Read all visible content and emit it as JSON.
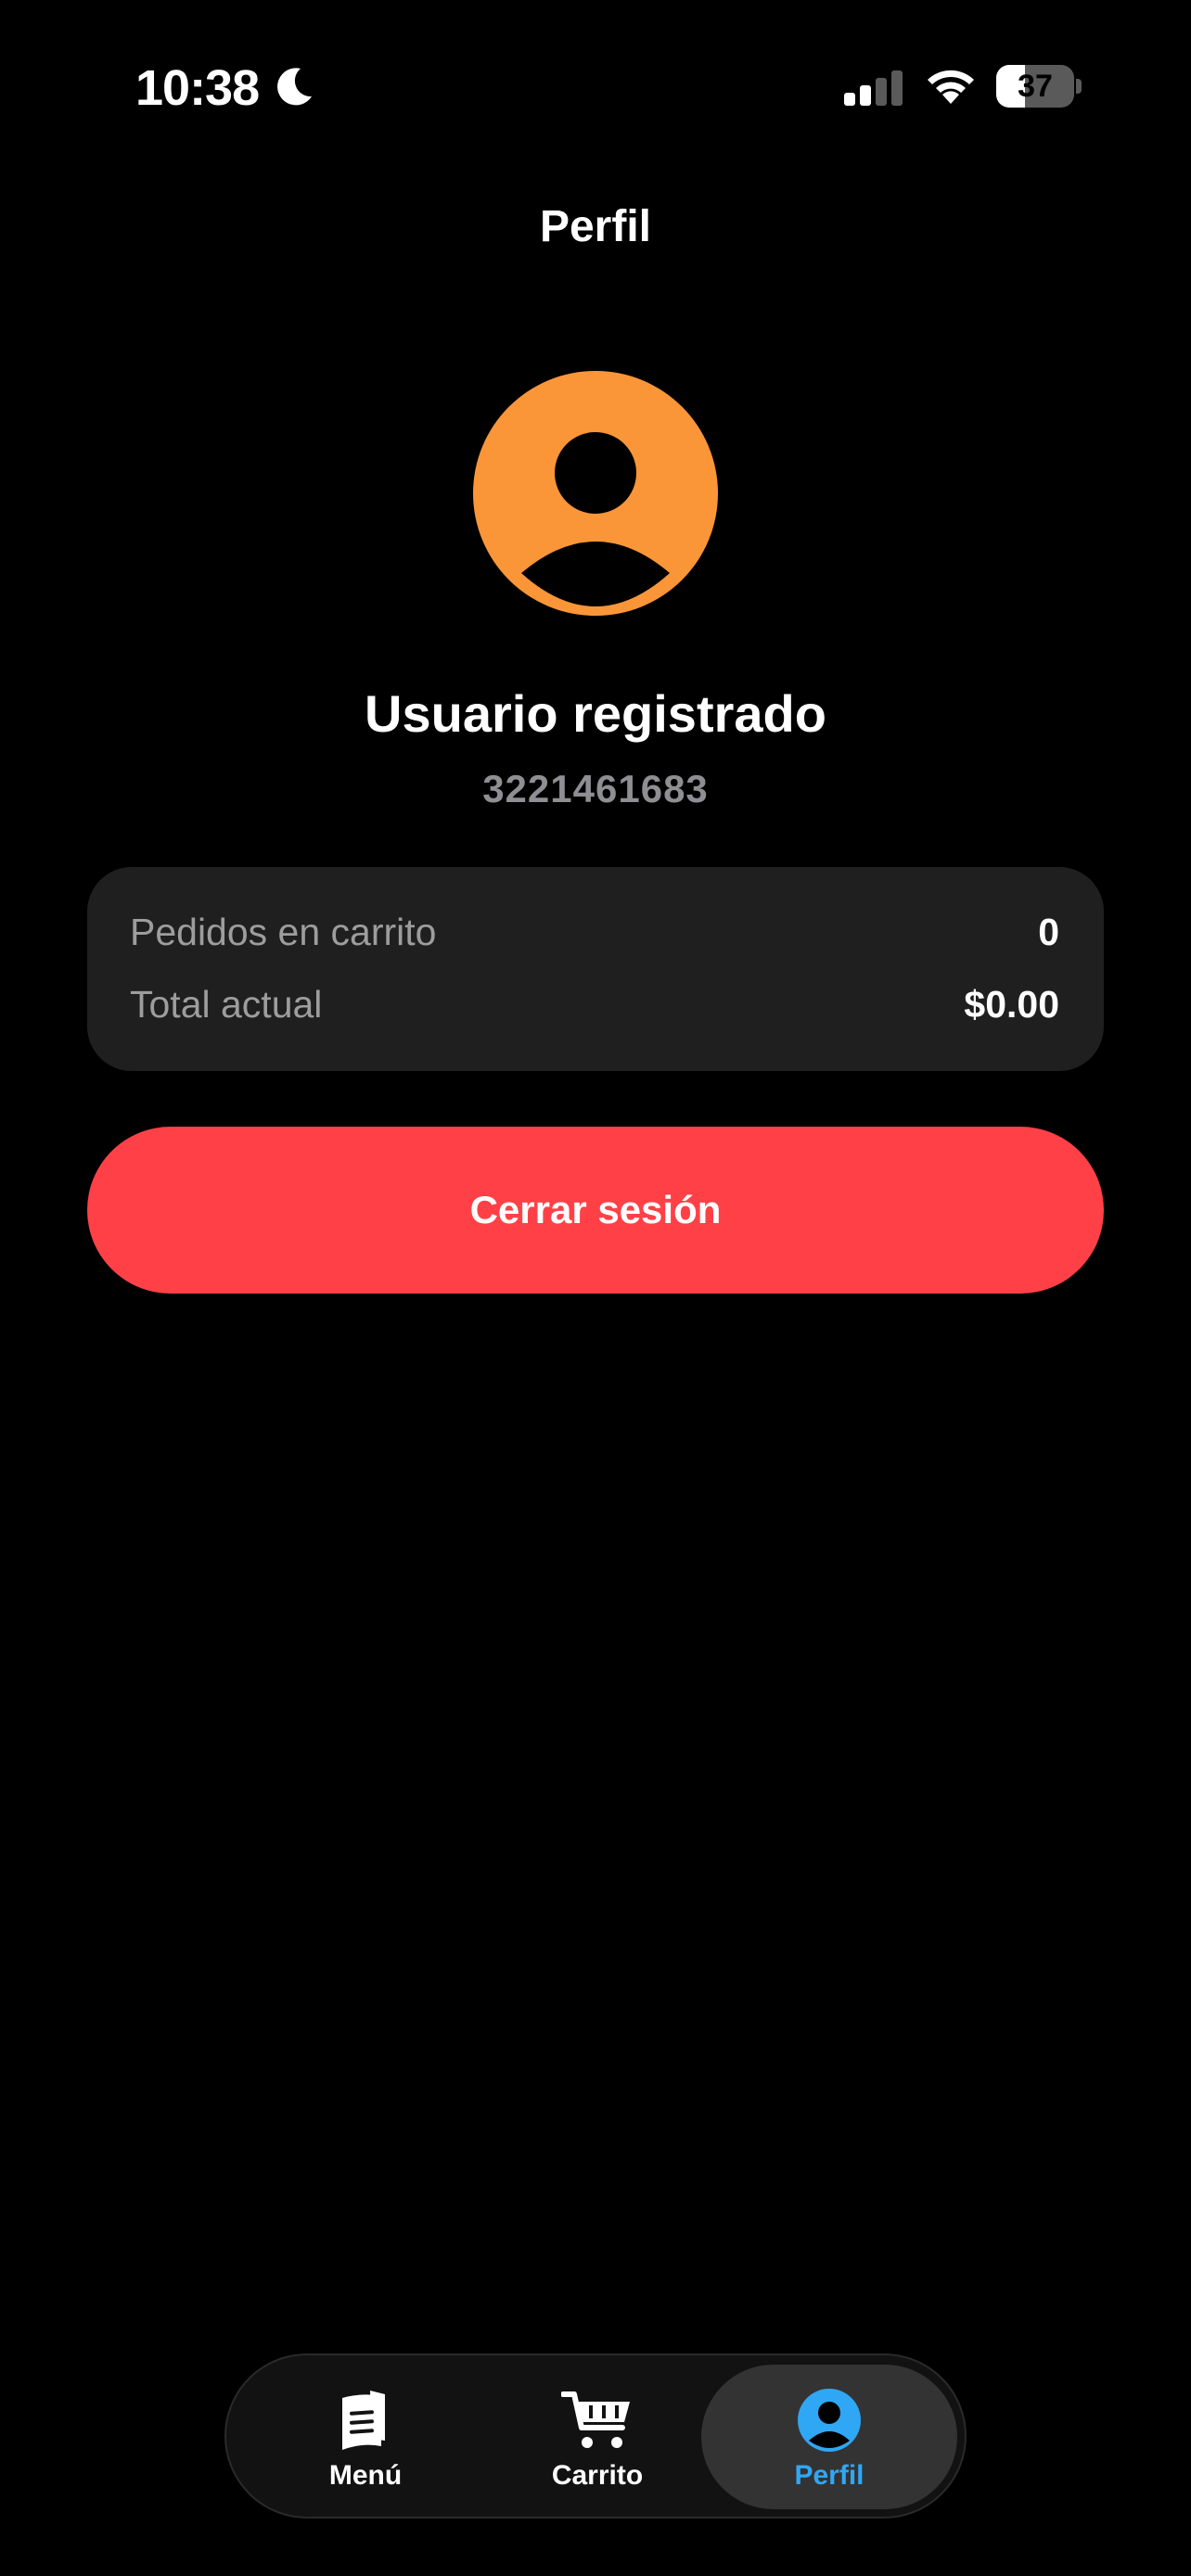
{
  "status_bar": {
    "time": "10:38",
    "battery_level": "37",
    "icons": [
      "moon-icon",
      "signal-icon",
      "wifi-icon",
      "battery-icon"
    ]
  },
  "header": {
    "title": "Perfil"
  },
  "profile": {
    "name": "Usuario registrado",
    "phone": "3221461683",
    "avatar_color": "#fb9638"
  },
  "summary": {
    "rows": [
      {
        "label": "Pedidos en carrito",
        "value": "0"
      },
      {
        "label": "Total actual",
        "value": "$0.00"
      }
    ]
  },
  "logout": {
    "label": "Cerrar sesión",
    "color": "#ff4147"
  },
  "tab_bar": {
    "items": [
      {
        "label": "Menú",
        "icon": "menu-book-icon",
        "active": false
      },
      {
        "label": "Carrito",
        "icon": "cart-icon",
        "active": false
      },
      {
        "label": "Perfil",
        "icon": "profile-icon",
        "active": true
      }
    ],
    "active_color": "#2fa7f5"
  }
}
